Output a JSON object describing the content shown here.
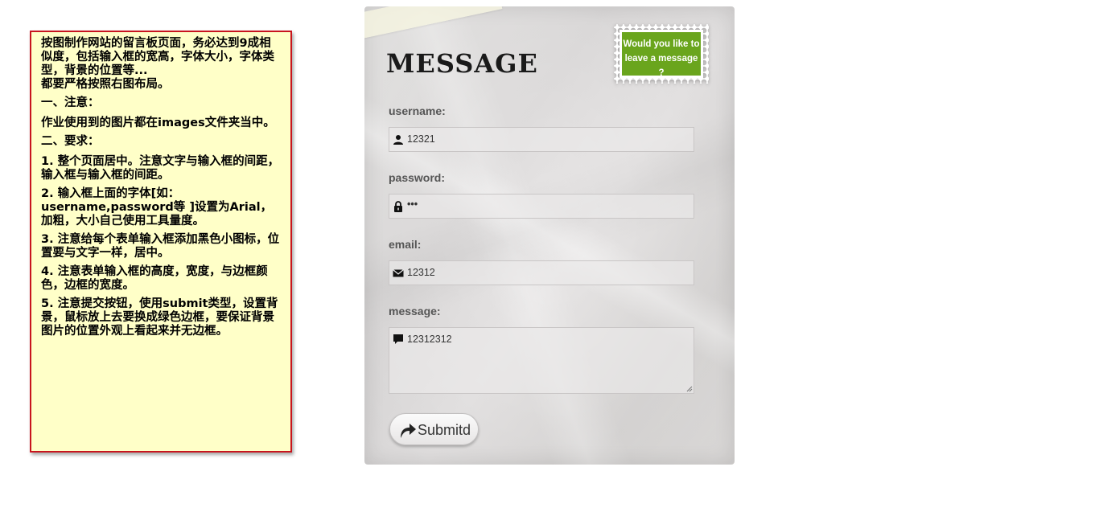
{
  "notes": {
    "intro": "按图制作网站的留言板页面，务必达到9成相似度，包括输入框的宽高，字体大小，字体类型，背景的位置等...\n都要严格按照右图布局。",
    "section1_heading": "一、注意：",
    "section1_text": "作业使用到的图片都在images文件夹当中。",
    "section2_heading": "二、要求：",
    "req1": "1. 整个页面居中。注意文字与输入框的间距，输入框与输入框的间距。",
    "req2": "2. 输入框上面的字体[如：username,password等 ]设置为Arial，加粗，大小自己使用工具量度。",
    "req3": "3. 注意给每个表单输入框添加黑色小图标，位置要与文字一样，居中。",
    "req4": "4. 注意表单输入框的高度，宽度，与边框颜色，边框的宽度。",
    "req5": "5. 注意提交按钮，使用submit类型，设置背景，鼠标放上去要换成绿色边框，要保证背景图片的位置外观上看起来并无边框。"
  },
  "board": {
    "title": "MESSAGE",
    "stamp_line1": "Would you like to",
    "stamp_line2": "leave a message ?",
    "username_label": "username:",
    "username_value": "12321",
    "password_label": "password:",
    "password_value": "•••",
    "email_label": "email:",
    "email_value": "12312",
    "message_label": "message:",
    "message_value": "12312312",
    "submit_label": "Submitd"
  },
  "colors": {
    "notes_bg": "#ffffc8",
    "notes_border": "#c8141e",
    "stamp_green": "#6aa51d"
  },
  "icons": [
    "user-icon",
    "lock-icon",
    "envelope-icon",
    "speech-bubble-icon",
    "share-arrow-icon"
  ]
}
